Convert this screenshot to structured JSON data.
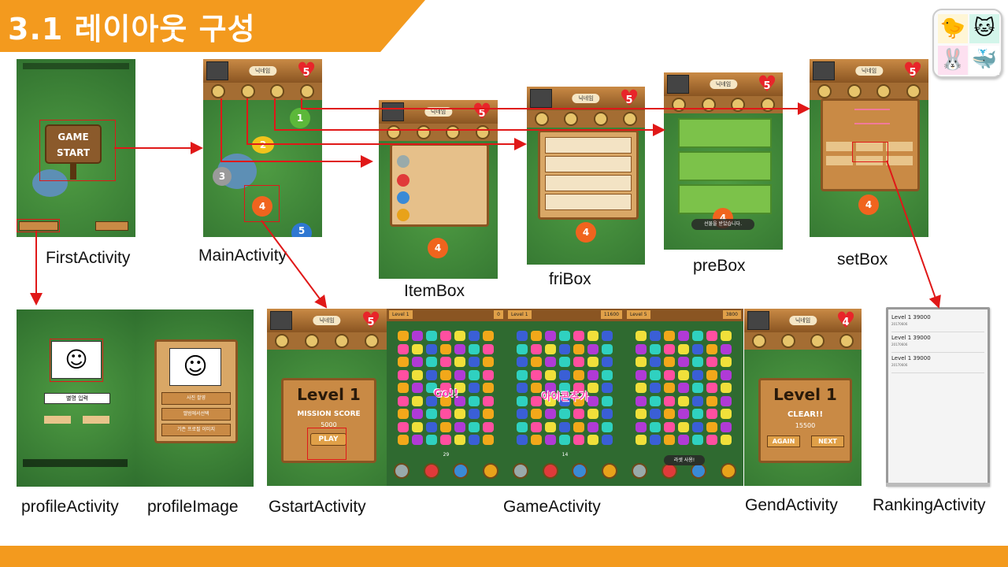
{
  "title": "3.1 레이아웃 구성",
  "colors": {
    "orange": "#f39a1e",
    "arrow": "#e01818",
    "grass": "#3d8b3a",
    "wood": "#b9793a"
  },
  "logo": {
    "icons": [
      "bird-icon",
      "cat-icon",
      "rabbit-icon",
      "whale-icon"
    ]
  },
  "screens": {
    "first": {
      "label": "FirstActivity",
      "game_start": "GAME START"
    },
    "main": {
      "label": "MainActivity",
      "hearts": "5",
      "levels": [
        "1",
        "2",
        "3",
        "4",
        "5"
      ]
    },
    "itembox": {
      "label": "ItemBox",
      "level": "4"
    },
    "fribox": {
      "label": "friBox",
      "level": "4"
    },
    "prebox": {
      "label": "preBox",
      "toast": "선물을 받았습니다.",
      "level": "4"
    },
    "setbox": {
      "label": "setBox",
      "level": "4"
    },
    "profile": {
      "label": "profileActivity",
      "name_input": "별명 입력"
    },
    "profile_image": {
      "label": "profileImage",
      "buttons": [
        "사진 촬영",
        "앨범에서선택",
        "기존 프로필 이미지"
      ]
    },
    "gstart": {
      "label": "GstartActivity",
      "level": "Level 1",
      "mission": "MISSION SCORE",
      "score": "5000",
      "play": "PLAY"
    },
    "game": {
      "label": "GameActivity",
      "panels": [
        {
          "level": "Level 1",
          "score": "0",
          "overlay": "Go!!",
          "moves": "29"
        },
        {
          "level": "Level 1",
          "score": "11600",
          "overlay": "아이콘추가",
          "moves": "14"
        },
        {
          "level": "Level 5",
          "score": "3800",
          "overlay": "",
          "moves": ""
        }
      ],
      "toast": "라셋 사용!"
    },
    "gend": {
      "label": "GendActivity",
      "hearts": "4",
      "level": "Level 1",
      "clear": "CLEAR!!",
      "score": "15500",
      "again": "AGAIN",
      "next": "NEXT"
    },
    "ranking": {
      "label": "RankingActivity",
      "rows": [
        {
          "title": "Level 1  39000",
          "date": "20170606"
        },
        {
          "title": "Level 1  39000",
          "date": "20170606"
        },
        {
          "title": "Level 1  39000",
          "date": "20170606"
        }
      ]
    }
  }
}
